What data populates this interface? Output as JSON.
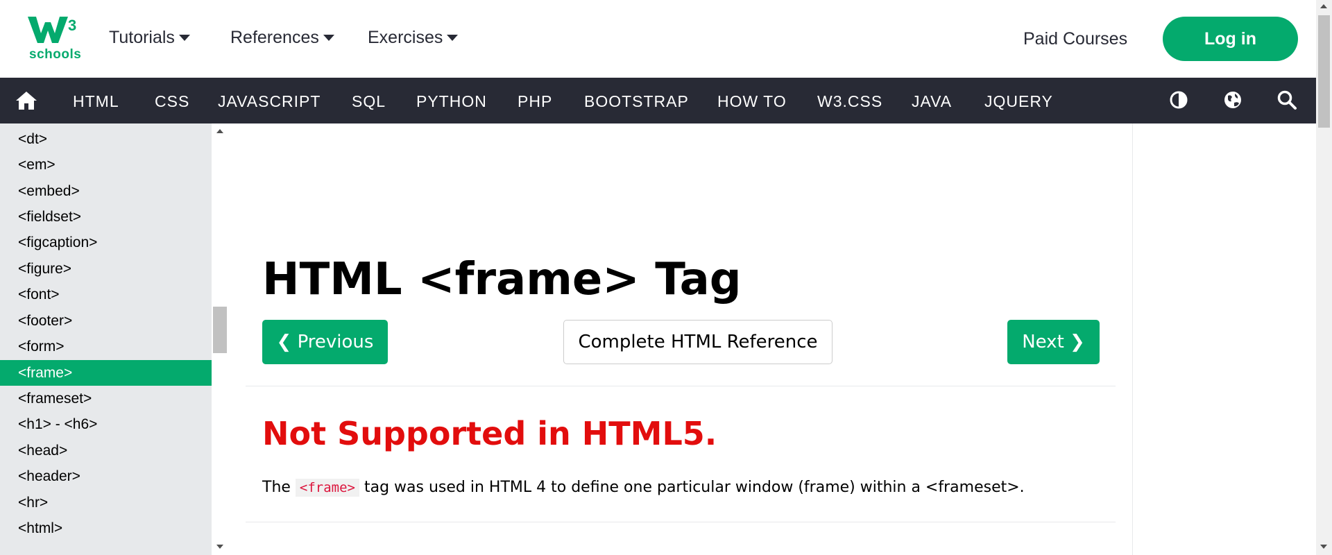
{
  "header": {
    "logo_sup": "3",
    "logo_text": "schools",
    "menus": [
      {
        "label": "Tutorials"
      },
      {
        "label": "References"
      },
      {
        "label": "Exercises"
      }
    ],
    "paid_courses": "Paid Courses",
    "login": "Log in"
  },
  "nav": {
    "items": [
      "HTML",
      "CSS",
      "JAVASCRIPT",
      "SQL",
      "PYTHON",
      "PHP",
      "BOOTSTRAP",
      "HOW TO",
      "W3.CSS",
      "JAVA",
      "JQUERY"
    ],
    "icons": [
      "home-icon",
      "contrast-icon",
      "globe-icon",
      "search-icon"
    ]
  },
  "sidebar": {
    "items": [
      "<dt>",
      "<em>",
      "<embed>",
      "<fieldset>",
      "<figcaption>",
      "<figure>",
      "<font>",
      "<footer>",
      "<form>",
      "<frame>",
      "<frameset>",
      "<h1> - <h6>",
      "<head>",
      "<header>",
      "<hr>",
      "<html>"
    ],
    "active": "<frame>"
  },
  "main": {
    "title": "HTML <frame> Tag",
    "prev_button": "❮ Previous",
    "reference_button": "Complete HTML Reference",
    "next_button": "Next ❯",
    "not_supported": "Not Supported in HTML5.",
    "para_before": "The ",
    "para_code": "<frame>",
    "para_after": " tag was used in HTML 4 to define one particular window (frame) within a <frameset>."
  },
  "colors": {
    "brand_green": "#04AA6D",
    "nav_dark": "#282A35",
    "sidebar_bg": "#E7E9EB",
    "warning_red": "#E20D0D"
  }
}
